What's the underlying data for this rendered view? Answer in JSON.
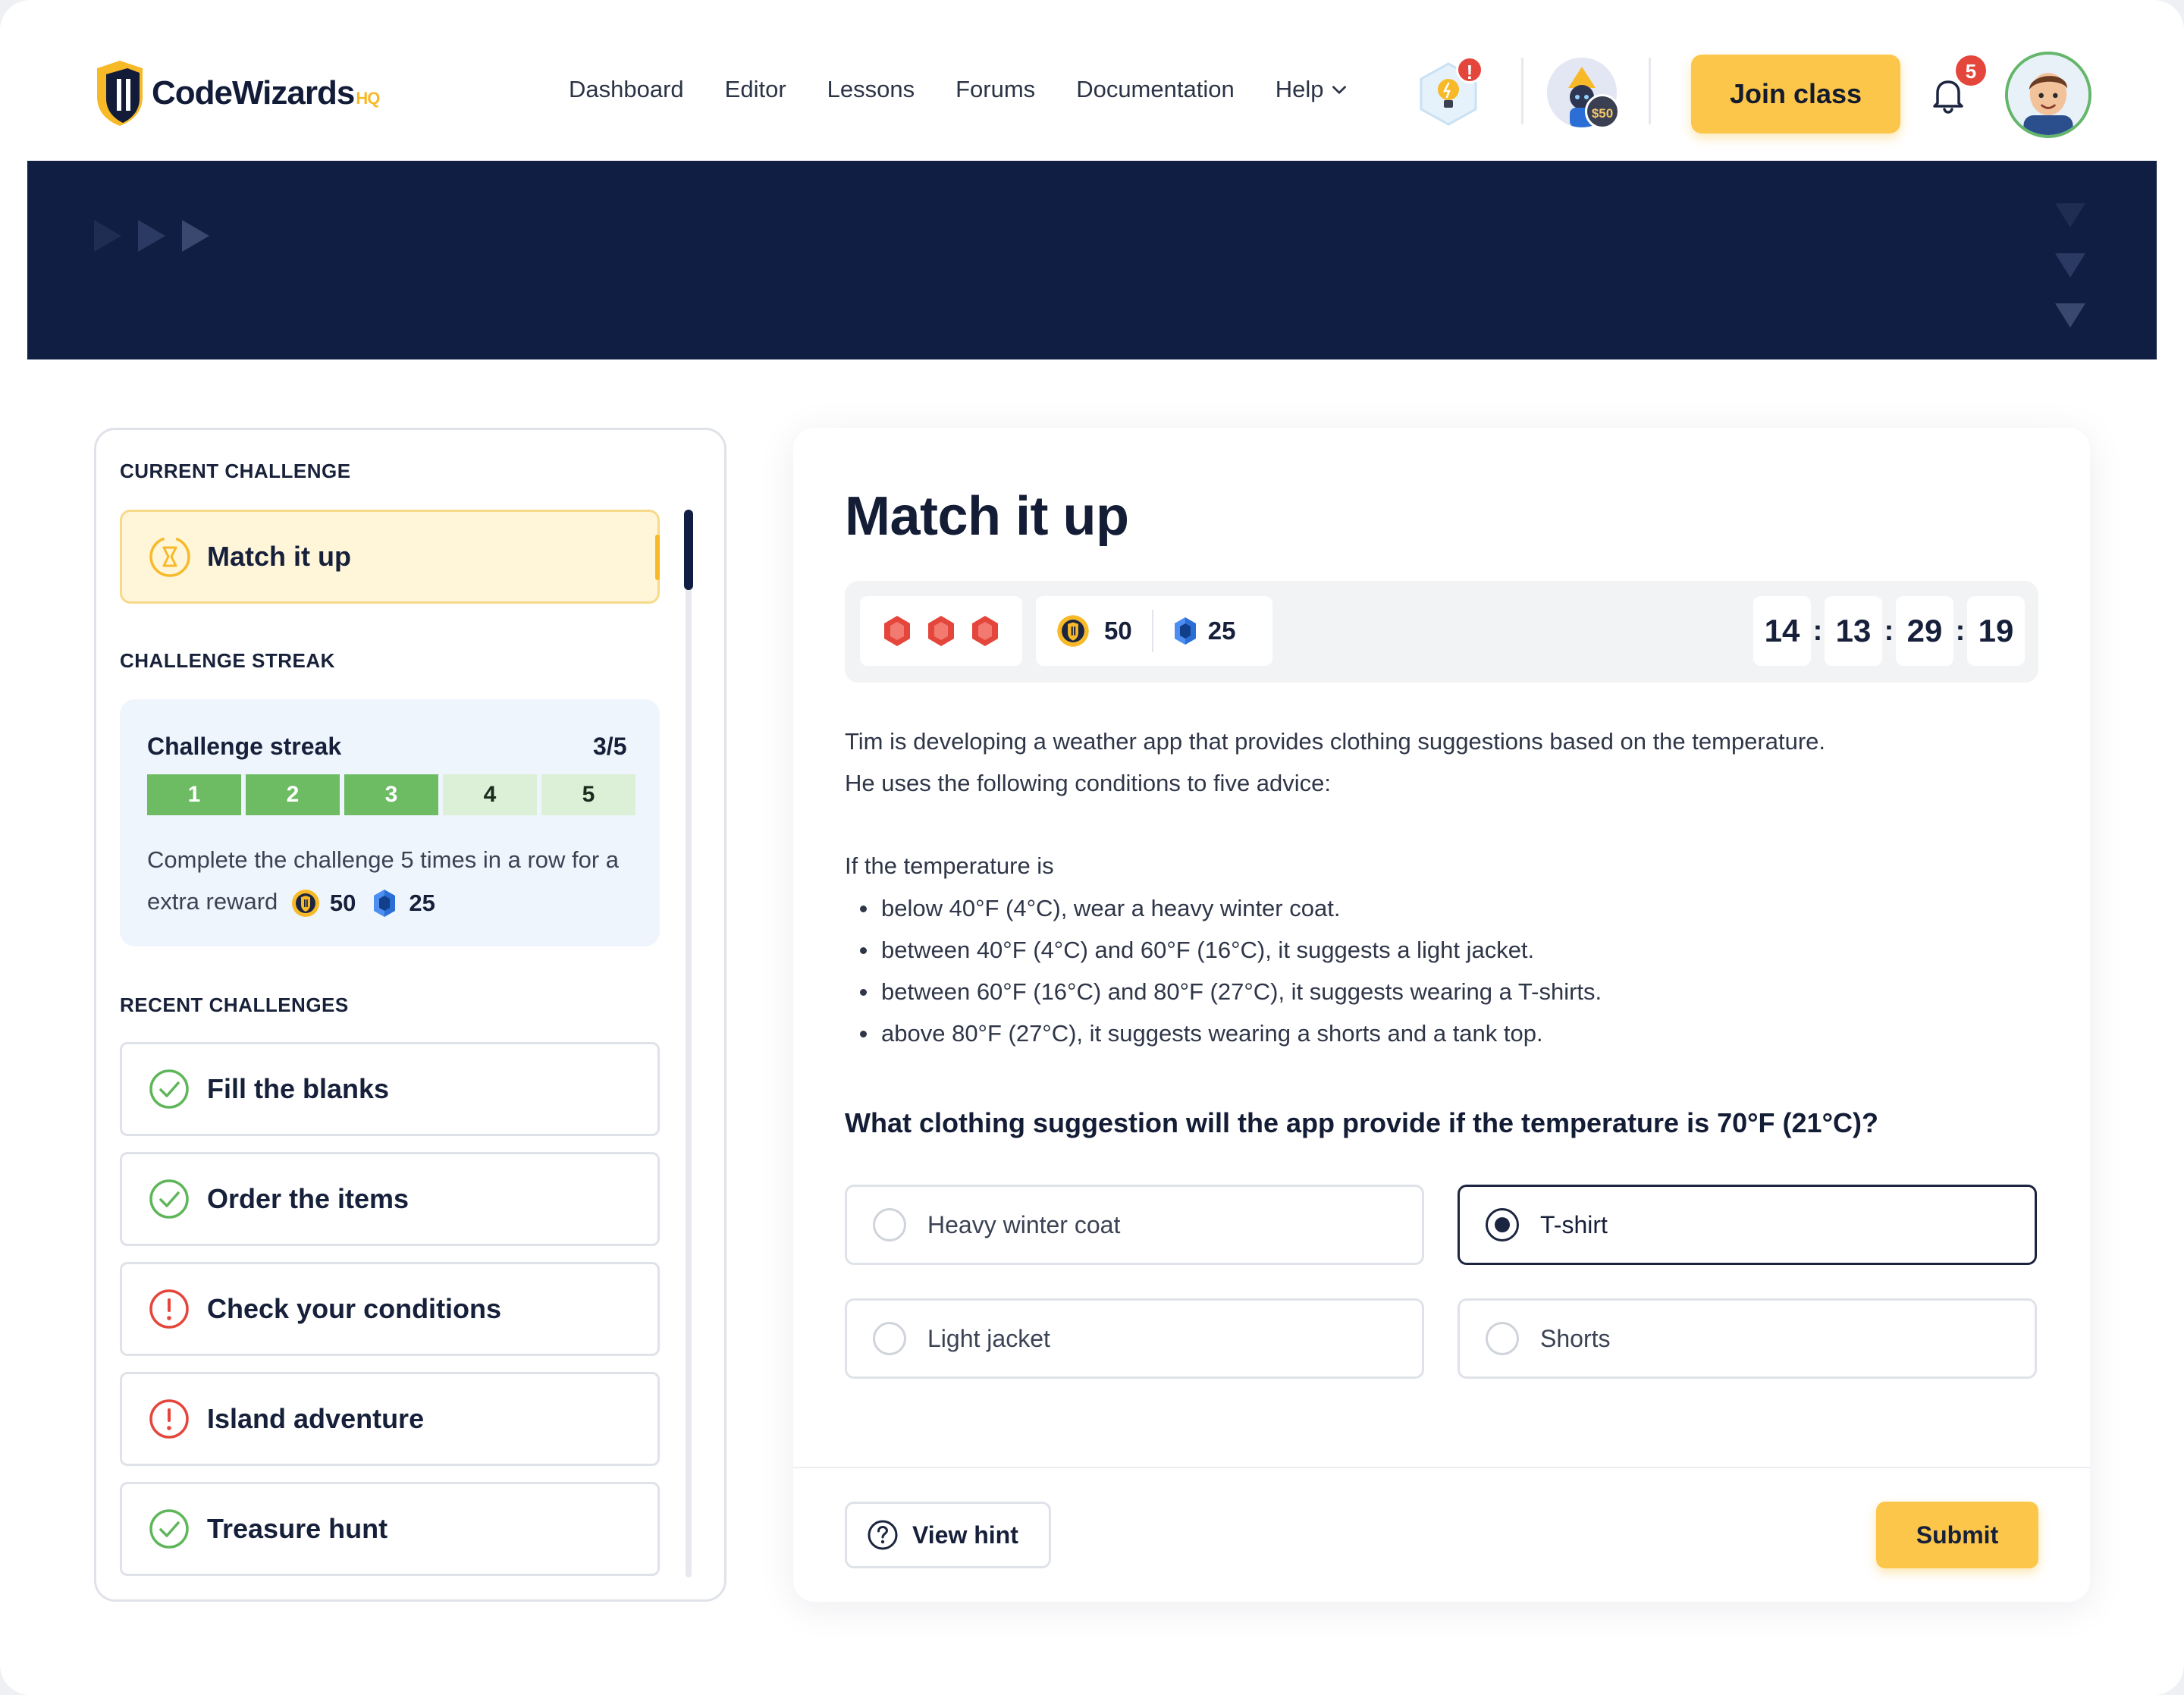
{
  "header": {
    "logo_text": "CodeWizards",
    "logo_suffix": "HQ",
    "nav": [
      "Dashboard",
      "Editor",
      "Lessons",
      "Forums",
      "Documentation",
      "Help"
    ],
    "hint_alert": "!",
    "coin_badge": "$50",
    "join_label": "Join class",
    "notification_count": "5"
  },
  "sidebar": {
    "current_label": "CURRENT CHALLENGE",
    "current_title": "Match it up",
    "streak_label": "CHALLENGE STREAK",
    "streak_title": "Challenge streak",
    "streak_count": "3/5",
    "streak_cells": [
      {
        "label": "1",
        "done": true
      },
      {
        "label": "2",
        "done": true
      },
      {
        "label": "3",
        "done": true
      },
      {
        "label": "4",
        "done": false
      },
      {
        "label": "5",
        "done": false
      }
    ],
    "streak_desc": "Complete the challenge 5 times in a row for a extra reward",
    "streak_coins": "50",
    "streak_gems": "25",
    "recent_label": "RECENT CHALLENGES",
    "recent": [
      {
        "title": "Fill the blanks",
        "status": "completed",
        "icon": "check-circle-icon"
      },
      {
        "title": "Order the items",
        "status": "completed",
        "icon": "check-circle-icon"
      },
      {
        "title": "Check your conditions",
        "status": "failed",
        "icon": "alert-circle-icon"
      },
      {
        "title": "Island adventure",
        "status": "failed",
        "icon": "alert-circle-icon"
      },
      {
        "title": "Treasure hunt",
        "status": "completed",
        "icon": "check-circle-icon"
      }
    ]
  },
  "main": {
    "title": "Match it up",
    "lives": 3,
    "coins": "50",
    "gems": "25",
    "timer": [
      "14",
      "13",
      "29",
      "19"
    ],
    "intro_line1": "Tim is developing a weather app that provides clothing suggestions based on the temperature.",
    "intro_line2": "He uses the following conditions to five advice:",
    "condition_intro": "If the temperature is",
    "conditions": [
      "below 40°F (4°C), wear a heavy winter coat.",
      "between 40°F (4°C) and 60°F (16°C), it suggests a light jacket.",
      "between 60°F (16°C) and 80°F (27°C), it suggests wearing a T-shirts.",
      "above 80°F (27°C), it suggests wearing a shorts and a tank top."
    ],
    "question": "What clothing suggestion will the app provide if the temperature is 70°F (21°C)?",
    "options": [
      {
        "label": "Heavy winter coat",
        "selected": false
      },
      {
        "label": "T-shirt",
        "selected": true
      },
      {
        "label": "Light jacket",
        "selected": false
      },
      {
        "label": "Shorts",
        "selected": false
      }
    ],
    "hint_label": "View hint",
    "submit_label": "Submit"
  },
  "colors": {
    "accent": "#fcc64b",
    "navy": "#0f1e42",
    "success": "#6dbb63",
    "danger": "#e5463c"
  }
}
